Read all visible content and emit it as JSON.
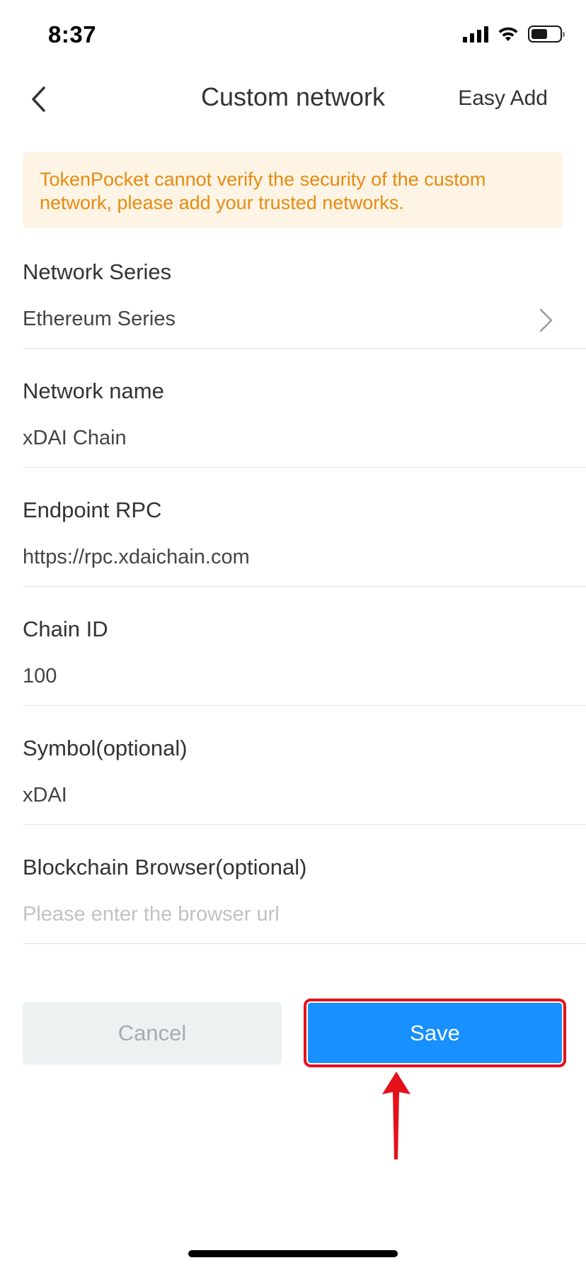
{
  "status_bar": {
    "time": "8:37"
  },
  "header": {
    "title": "Custom network",
    "action_label": "Easy Add",
    "back_icon": "chevron-left-icon"
  },
  "warning": {
    "text": "TokenPocket cannot verify the security of the custom network, please add your trusted networks.",
    "text_color": "#e88a0f",
    "background": "#fdf4e5"
  },
  "form": {
    "network_series": {
      "label": "Network Series",
      "value": "Ethereum Series"
    },
    "network_name": {
      "label": "Network name",
      "value": "xDAI Chain"
    },
    "endpoint_rpc": {
      "label": "Endpoint RPC",
      "value": "https://rpc.xdaichain.com"
    },
    "chain_id": {
      "label": "Chain ID",
      "value": "100"
    },
    "symbol": {
      "label": "Symbol(optional)",
      "value": "xDAI"
    },
    "blockchain_browser": {
      "label": "Blockchain Browser(optional)",
      "value": "",
      "placeholder": "Please enter the browser url"
    }
  },
  "buttons": {
    "cancel_label": "Cancel",
    "save_label": "Save"
  },
  "colors": {
    "accent": "#1890ff",
    "highlight": "#e5111a"
  }
}
